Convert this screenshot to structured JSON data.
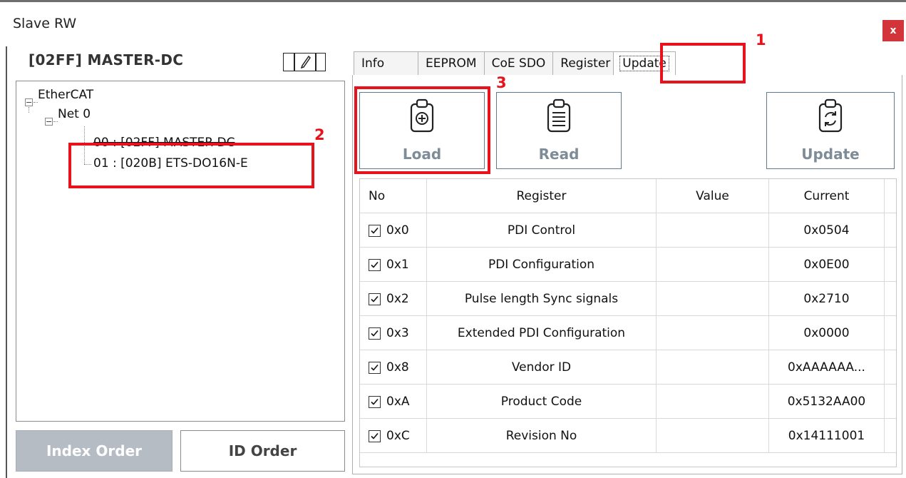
{
  "window": {
    "title": "Slave RW",
    "close_label": "x"
  },
  "device": {
    "title": "[02FF] MASTER-DC"
  },
  "tree": {
    "root": "EtherCAT",
    "net": "Net 0",
    "nodes": [
      "00 : [02FF] MASTER-DC",
      "01 : [020B] ETS-DO16N-E"
    ]
  },
  "order_buttons": {
    "index": "Index Order",
    "id": "ID Order"
  },
  "tabs": [
    "Info",
    "EEPROM",
    "CoE SDO",
    "Register",
    "Update"
  ],
  "active_tab": "Update",
  "toolbar": {
    "load": "Load",
    "read": "Read",
    "update": "Update"
  },
  "table": {
    "headers": [
      "No",
      "Register",
      "Value",
      "Current"
    ],
    "rows": [
      {
        "checked": true,
        "no": "0x0",
        "register": "PDI Control",
        "value": "",
        "current": "0x0504"
      },
      {
        "checked": true,
        "no": "0x1",
        "register": "PDI Configuration",
        "value": "",
        "current": "0x0E00"
      },
      {
        "checked": true,
        "no": "0x2",
        "register": "Pulse length Sync signals",
        "value": "",
        "current": "0x2710"
      },
      {
        "checked": true,
        "no": "0x3",
        "register": "Extended PDI Configuration",
        "value": "",
        "current": "0x0000"
      },
      {
        "checked": true,
        "no": "0x8",
        "register": "Vendor ID",
        "value": "",
        "current": "0xAAAAAA..."
      },
      {
        "checked": true,
        "no": "0xA",
        "register": "Product Code",
        "value": "",
        "current": "0x5132AA00"
      },
      {
        "checked": true,
        "no": "0xC",
        "register": "Revision No",
        "value": "",
        "current": "0x14111001"
      }
    ]
  },
  "annotations": [
    "1",
    "2",
    "3"
  ],
  "colors": {
    "highlight": "#e8121c",
    "close": "#d2343a",
    "button_border": "#5f7a91",
    "disabled_button": "#b5bcc4"
  }
}
